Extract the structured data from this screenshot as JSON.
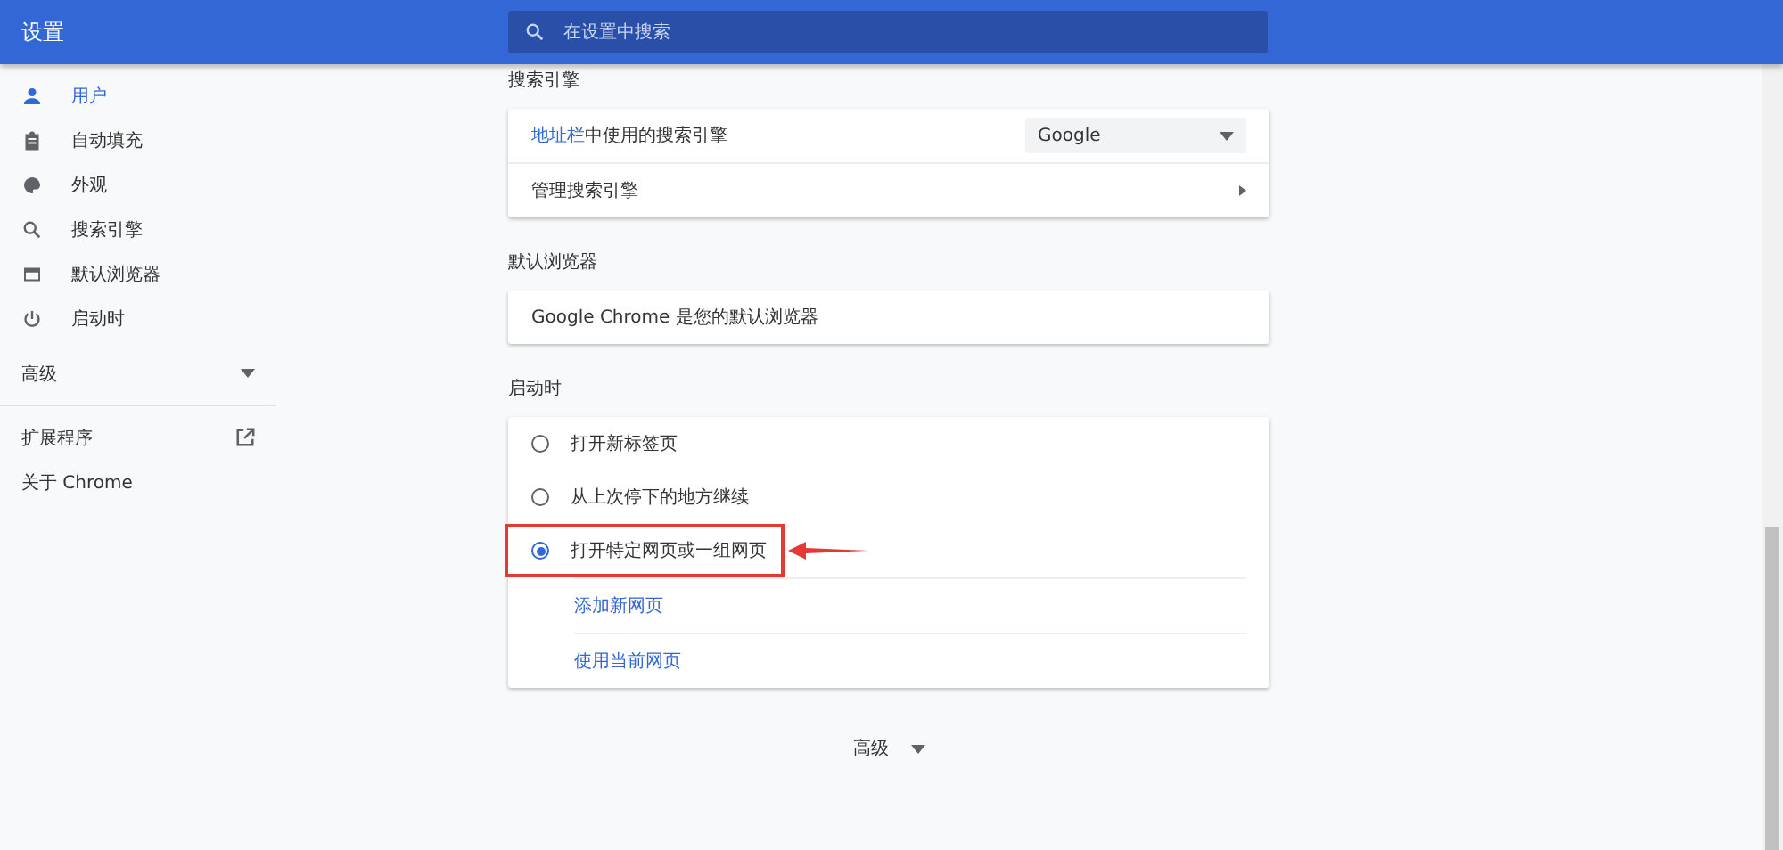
{
  "header": {
    "title": "设置",
    "search": {
      "placeholder": "在设置中搜索"
    }
  },
  "sidebar": {
    "items": [
      {
        "label": "用户",
        "selected": true
      },
      {
        "label": "自动填充",
        "selected": false
      },
      {
        "label": "外观",
        "selected": false
      },
      {
        "label": "搜索引擎",
        "selected": false
      },
      {
        "label": "默认浏览器",
        "selected": false
      },
      {
        "label": "启动时",
        "selected": false
      }
    ],
    "advanced": {
      "label": "高级"
    },
    "extensions": {
      "label": "扩展程序"
    },
    "about": {
      "label": "关于 Chrome"
    }
  },
  "search_engine": {
    "title": "搜索引擎",
    "address_bar_link": "地址栏",
    "address_bar_text": "中使用的搜索引擎",
    "engine": "Google",
    "manage": "管理搜索引擎"
  },
  "default_browser": {
    "title": "默认浏览器",
    "text": "Google Chrome 是您的默认浏览器"
  },
  "startup": {
    "title": "启动时",
    "options": [
      {
        "label": "打开新标签页",
        "selected": false
      },
      {
        "label": "从上次停下的地方继续",
        "selected": false
      },
      {
        "label": "打开特定网页或一组网页",
        "selected": true
      }
    ],
    "links": [
      "添加新网页",
      "使用当前网页"
    ]
  },
  "advanced_button": {
    "label": "高级"
  }
}
